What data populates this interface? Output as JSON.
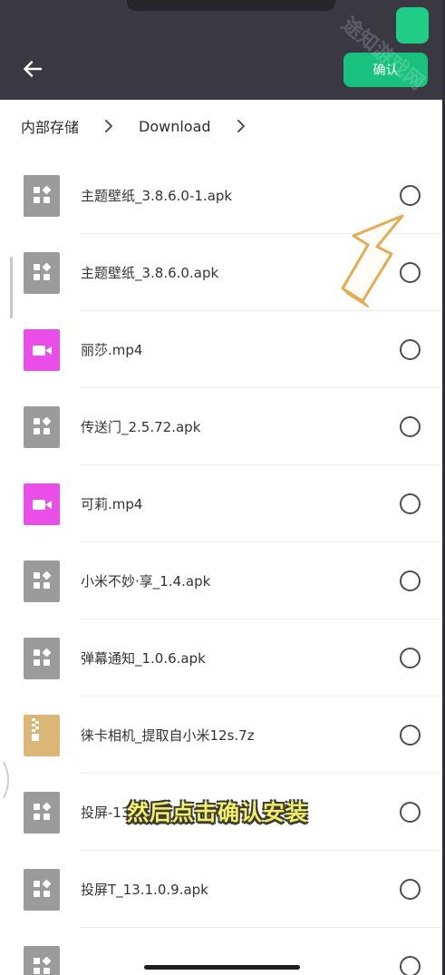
{
  "header": {
    "confirm_label": "确认",
    "watermark_text": "途知游戏网",
    "accent_color": "#18c17d"
  },
  "breadcrumb": {
    "items": [
      "内部存储",
      "Download"
    ]
  },
  "files": [
    {
      "name": "主题壁纸_3.8.6.0-1.apk",
      "type": "apk"
    },
    {
      "name": "主题壁纸_3.8.6.0.apk",
      "type": "apk"
    },
    {
      "name": "丽莎.mp4",
      "type": "video"
    },
    {
      "name": "传送门_2.5.72.apk",
      "type": "apk"
    },
    {
      "name": "可莉.mp4",
      "type": "video"
    },
    {
      "name": "小米不妙·享_1.4.apk",
      "type": "apk"
    },
    {
      "name": "弹幕通知_1.0.6.apk",
      "type": "apk"
    },
    {
      "name": "徕卡相机_提取自小米12s.7z",
      "type": "archive"
    },
    {
      "name": "投屏-13",
      "type": "apk"
    },
    {
      "name": "投屏T_13.1.0.9.apk",
      "type": "apk"
    },
    {
      "name": "",
      "type": "apk"
    }
  ],
  "subtitle": "然后点击确认安装",
  "icons": {
    "back": "back-arrow-icon",
    "apk": "apk-file-icon",
    "video": "video-file-icon",
    "archive": "archive-file-icon",
    "chevron": "chevron-right-icon"
  }
}
